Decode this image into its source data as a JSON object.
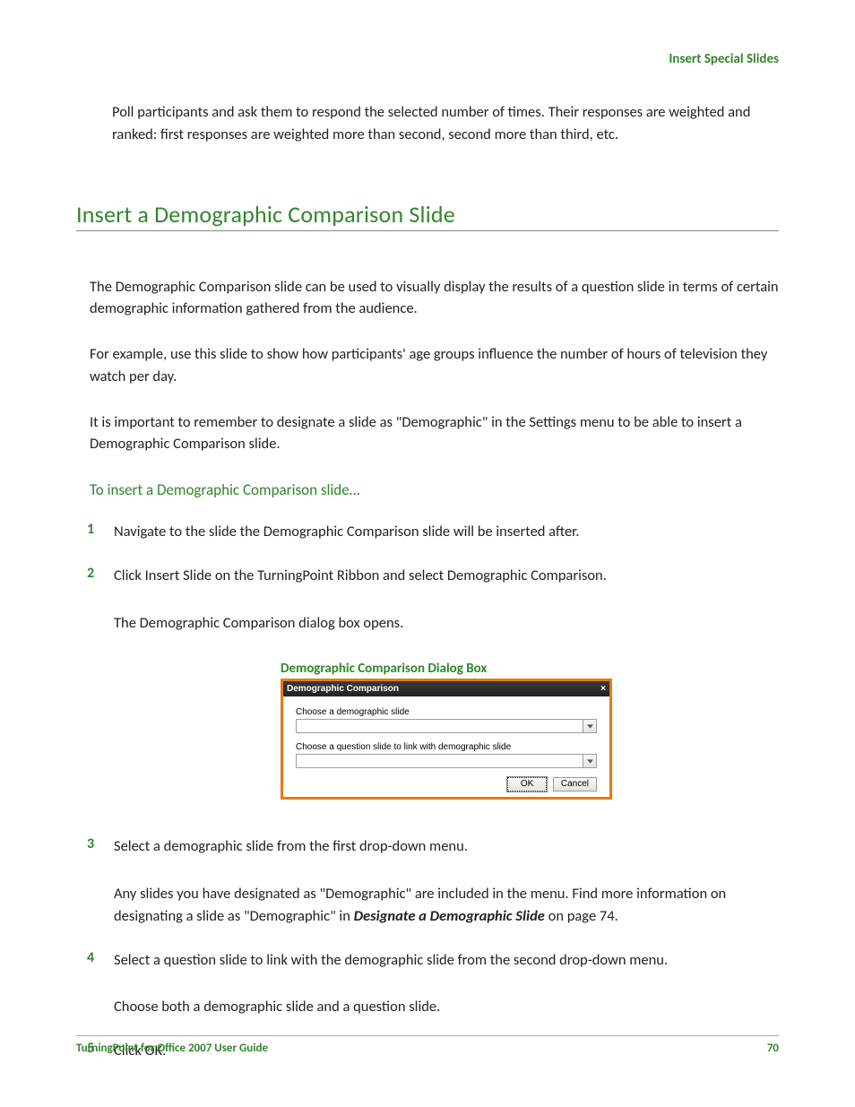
{
  "breadcrumb": "Insert Special Slides",
  "intro": "Poll participants and ask them to respond the selected number of times. Their responses are weighted and ranked: first responses are weighted more than second, second more than third, etc.",
  "section_title": "Insert a Demographic Comparison Slide",
  "para1": "The Demographic Comparison slide can be used to visually display the results of a question slide in terms of certain demographic information gathered from the audience.",
  "para2": "For example, use this slide to show how participants' age groups influence the number of hours of television they watch per day.",
  "para3": "It is important to remember to designate a slide as \"Demographic\" in the Settings menu to be able to insert a Demographic Comparison slide.",
  "subhead": "To insert a Demographic Comparison slide…",
  "steps": {
    "s1_num": "1",
    "s1": "Navigate to the slide the Demographic Comparison slide will be inserted after.",
    "s2_num": "2",
    "s2": "Click Insert Slide on the TurningPoint Ribbon and select Demographic Comparison.",
    "s2_sub": "The Demographic Comparison dialog box opens.",
    "s3_num": "3",
    "s3": "Select a demographic slide from the first drop-down menu.",
    "s3_sub_pre": "Any slides you have designated as \"Demographic\" are included in the menu. Find more information on designating a slide as \"Demographic\" in ",
    "s3_sub_xref": "Designate a Demographic Slide",
    "s3_sub_post": " on page 74.",
    "s4_num": "4",
    "s4": "Select a question slide to link with the demographic slide from the second drop-down menu.",
    "s4_sub": "Choose both a demographic slide and a question slide.",
    "s5_num": "5",
    "s5": "Click OK."
  },
  "figure_caption": "Demographic Comparison Dialog Box",
  "dialog": {
    "title": "Demographic Comparison",
    "close_glyph": "×",
    "label1": "Choose a demographic slide",
    "combo1_value": "",
    "label2": "Choose a question slide to link with demographic slide",
    "combo2_value": "",
    "ok": "OK",
    "cancel": "Cancel"
  },
  "footer": {
    "doc_title": "TurningPoint for Office 2007 User Guide",
    "page_num": "70"
  }
}
